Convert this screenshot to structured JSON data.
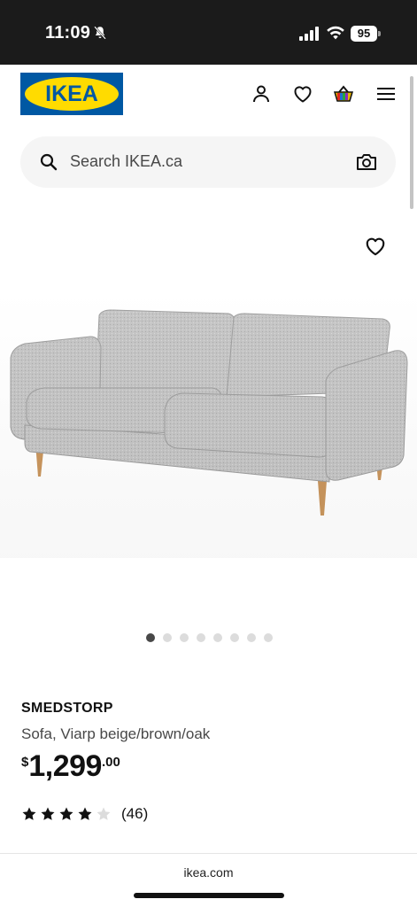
{
  "status_bar": {
    "time": "11:09",
    "battery": "95",
    "icons": [
      "bell-slash-icon",
      "signal-icon",
      "wifi-icon",
      "battery-icon"
    ]
  },
  "header": {
    "logo_text": "IKEA",
    "icons": [
      "profile-icon",
      "heart-icon",
      "cart-icon",
      "menu-icon"
    ]
  },
  "search": {
    "placeholder": "Search IKEA.ca",
    "icons": [
      "search-icon",
      "camera-icon"
    ]
  },
  "gallery": {
    "slide_count": 8,
    "active_index": 0
  },
  "product": {
    "name": "SMEDSTORP",
    "description": "Sofa, Viarp beige/brown/oak",
    "price": {
      "currency": "$",
      "integer": "1,299",
      "cents": ".00"
    },
    "rating": {
      "stars": 4,
      "max": 5,
      "count": "(46)"
    }
  },
  "browser": {
    "url": "ikea.com"
  },
  "colors": {
    "ikea_blue": "#0058a3",
    "ikea_yellow": "#ffdb00",
    "status_bar": "#1b1b1b",
    "search_bg": "#f5f5f5"
  }
}
